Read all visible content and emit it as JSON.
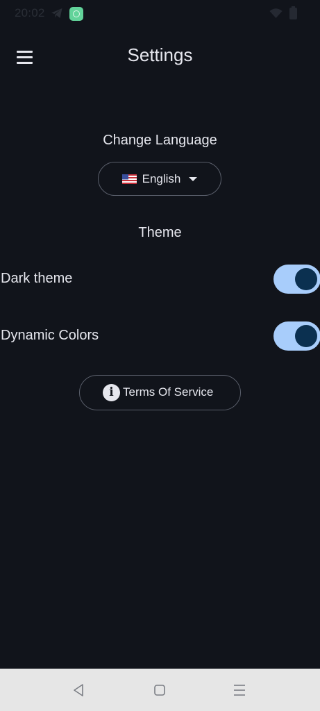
{
  "status_bar": {
    "time": "20:02",
    "icons": [
      "telegram-icon",
      "app-notification-icon",
      "wifi-icon",
      "battery-icon"
    ]
  },
  "app_bar": {
    "title": "Settings",
    "menu_icon": "hamburger-menu-icon"
  },
  "language": {
    "section_label": "Change Language",
    "selected_flag": "us-flag-icon",
    "selected_value": "English"
  },
  "theme": {
    "section_label": "Theme",
    "dark_theme": {
      "label": "Dark theme",
      "enabled": true
    },
    "dynamic_colors": {
      "label": "Dynamic Colors",
      "enabled": true
    }
  },
  "terms": {
    "label": "Terms Of Service",
    "icon": "info-icon"
  },
  "colors": {
    "background": "#11141b",
    "text": "#e6e7ee",
    "toggle_track": "#a8cdfb",
    "toggle_knob": "#0b3050",
    "outline": "#5a5f6b",
    "nav_bar": "#e6e6e6"
  },
  "nav_bar": {
    "icons": [
      "back-icon",
      "home-icon",
      "recents-icon"
    ]
  }
}
